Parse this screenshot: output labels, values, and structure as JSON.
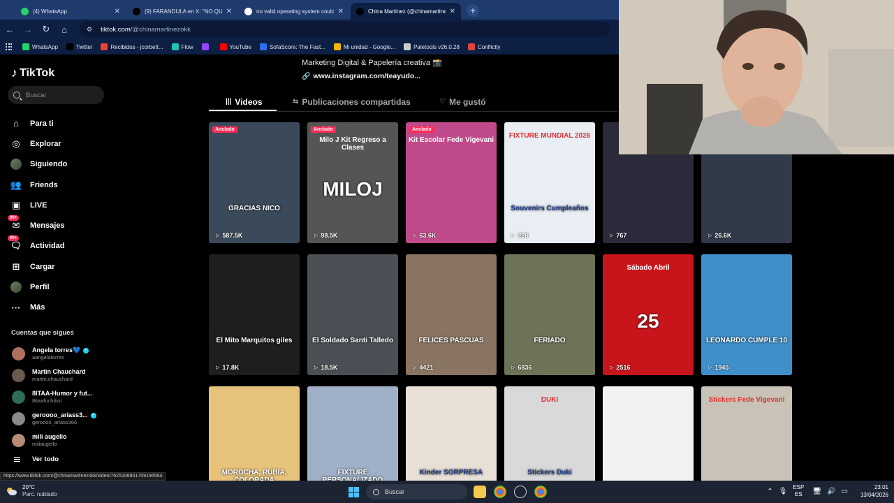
{
  "browser": {
    "tabs": [
      {
        "title": "(4) WhatsApp",
        "favicon": "whatsapp-icon",
        "color": "#25d366",
        "active": false
      },
      {
        "title": "(9) FARANDULA en X: \"NO QUI",
        "favicon": "x-icon",
        "color": "#000000",
        "active": false
      },
      {
        "title": "no valid operating system could",
        "favicon": "google-icon",
        "color": "#ffffff",
        "active": false
      },
      {
        "title": "China Martinez (@chinamartine",
        "favicon": "tiktok-icon",
        "color": "#000000",
        "active": true
      }
    ],
    "new_tab": "+",
    "url_domain": "tiktok.com",
    "url_path": "/@chinamartinezokk",
    "bookmarks": [
      {
        "label": "WhatsApp",
        "icon": "whatsapp-icon",
        "color": "#25d366"
      },
      {
        "label": "Twitter",
        "icon": "x-icon",
        "color": "#000000"
      },
      {
        "label": "Recibidos - jcorbett...",
        "icon": "gmail-icon",
        "color": "#ea4335"
      },
      {
        "label": "Flow",
        "icon": "flow-icon",
        "color": "#1fc6b5"
      },
      {
        "label": "",
        "icon": "twitch-icon",
        "color": "#9146ff"
      },
      {
        "label": "YouTube",
        "icon": "youtube-icon",
        "color": "#ff0000"
      },
      {
        "label": "SofaScore: The Fast...",
        "icon": "sofascore-icon",
        "color": "#2c6ff0"
      },
      {
        "label": "Mi unidad - Google...",
        "icon": "drive-icon",
        "color": "#f4b400"
      },
      {
        "label": "Paletools v26.0.28",
        "icon": "paletools-icon",
        "color": "#cccccc"
      },
      {
        "label": "Conflictly",
        "icon": "conflictly-icon",
        "color": "#e0443a"
      }
    ]
  },
  "sidebar": {
    "logo": "TikTok",
    "search_placeholder": "Buscar",
    "nav": [
      {
        "label": "Para ti",
        "icon": "home-icon"
      },
      {
        "label": "Explorar",
        "icon": "compass-icon"
      },
      {
        "label": "Siguiendo",
        "icon": "following-avatar-icon"
      },
      {
        "label": "Friends",
        "icon": "friends-icon"
      },
      {
        "label": "LIVE",
        "icon": "live-icon"
      },
      {
        "label": "Mensajes",
        "icon": "messages-icon",
        "badge": "99+"
      },
      {
        "label": "Actividad",
        "icon": "activity-icon",
        "badge": "99+"
      },
      {
        "label": "Cargar",
        "icon": "upload-icon"
      },
      {
        "label": "Perfil",
        "icon": "profile-avatar-icon"
      },
      {
        "label": "Más",
        "icon": "more-icon"
      }
    ],
    "following_title": "Cuentas que sigues",
    "following": [
      {
        "name": "Angela torres💙",
        "user": "aangelatorres",
        "verified": true,
        "color": "#b07060"
      },
      {
        "name": "Martin Chauchard",
        "user": "martin.chauchard",
        "verified": false,
        "color": "#6b5a4e"
      },
      {
        "name": "8ITAA-Humor y fut...",
        "user": "8itaafuchibol",
        "verified": false,
        "color": "#2f6b5a"
      },
      {
        "name": "geroooo_ariass3...",
        "user": "geroooo_ariass366",
        "verified": true,
        "color": "#8a8a8a"
      },
      {
        "name": "mili augello",
        "user": "miliaugello",
        "verified": false,
        "color": "#b58d76"
      }
    ],
    "see_all": "Ver todo"
  },
  "profile": {
    "bio_line": "Marketing Digital & Papelería creativa 📸",
    "link": "www.instagram.com/teayudo...",
    "tabs": [
      {
        "label": "Videos",
        "icon": "grid-icon",
        "active": true
      },
      {
        "label": "Publicaciones compartidas",
        "icon": "repost-icon",
        "active": false
      },
      {
        "label": "Me gustó",
        "icon": "heart-icon",
        "active": false
      }
    ],
    "pinned_label": "Anclado",
    "videos": [
      {
        "views": "587.5K",
        "pinned": true,
        "caption": "GRACIAS NICO",
        "top": "",
        "bg": "#3a4a5a"
      },
      {
        "views": "98.5K",
        "pinned": true,
        "caption": "MILOJ",
        "top": "Milo J Kit Regreso a Clases",
        "bg": "#555555"
      },
      {
        "views": "63.6K",
        "pinned": true,
        "caption": "",
        "top": "Kit Escolar Fede Vigevani",
        "bg": "#c04a8a"
      },
      {
        "views": "228",
        "pinned": false,
        "caption": "Souvenirs Cumpleaños",
        "top": "FIXTURE MUNDIAL 2026",
        "bg": "#e9eef5"
      },
      {
        "views": "767",
        "pinned": false,
        "caption": "",
        "top": "",
        "bg": "#2a2a3a"
      },
      {
        "views": "26.6K",
        "pinned": false,
        "caption": "",
        "top": "",
        "bg": "#303a48"
      },
      {
        "views": "17.8K",
        "pinned": false,
        "caption": "El Mito Marquitos giles",
        "top": "",
        "bg": "#1e1e1e"
      },
      {
        "views": "18.5K",
        "pinned": false,
        "caption": "El Soldado Santi Talledo",
        "top": "",
        "bg": "#4a4f55"
      },
      {
        "views": "4421",
        "pinned": false,
        "caption": "FELICES PASCUAS",
        "top": "",
        "bg": "#8a7563"
      },
      {
        "views": "6836",
        "pinned": false,
        "caption": "FERIADO",
        "top": "",
        "bg": "#6c7356"
      },
      {
        "views": "2516",
        "pinned": false,
        "caption": "25",
        "top": "Sábado Abril",
        "bg": "#c8151b"
      },
      {
        "views": "1945",
        "pinned": false,
        "caption": "LEONARDO CUMPLE 10",
        "top": "",
        "bg": "#3f8fc9"
      },
      {
        "views": "",
        "pinned": false,
        "caption": "MOROCHA, RUBIA, COLORADA",
        "top": "",
        "bg": "#e6c27a"
      },
      {
        "views": "",
        "pinned": false,
        "caption": "FIXTURE PERSONALIZADO",
        "top": "",
        "bg": "#9fb0c8"
      },
      {
        "views": "",
        "pinned": false,
        "caption": "Kinder SORPRESA",
        "top": "",
        "bg": "#e8e0d6"
      },
      {
        "views": "",
        "pinned": false,
        "caption": "Stickers Duki",
        "top": "DUKI",
        "bg": "#d9d9d9"
      },
      {
        "views": "",
        "pinned": false,
        "caption": "",
        "top": "",
        "bg": "#f2f2f2"
      },
      {
        "views": "",
        "pinned": false,
        "caption": "",
        "top": "Stickers Fede Vigevani",
        "bg": "#c9c2b6"
      }
    ]
  },
  "status_url": "https://www.tiktok.com/@chinamartinezokk/video/7625106901709196564",
  "taskbar": {
    "temp": "20°C",
    "weather": "Parc. nublado",
    "search": "Buscar",
    "lang_top": "ESP",
    "lang_bottom": "ES",
    "time": "23:01",
    "date": "13/04/2026"
  }
}
